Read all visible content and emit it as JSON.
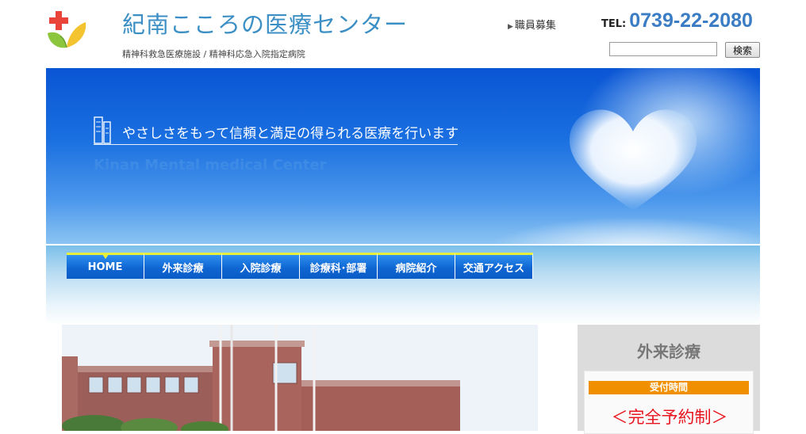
{
  "header": {
    "title": "紀南こころの医療センター",
    "subtitle": "精神科救急医療施設 / 精神科応急入院指定病院",
    "recruit_link": "職員募集",
    "tel_label": "TEL:",
    "tel_number": "0739-22-2080",
    "search": {
      "value": "",
      "placeholder": "",
      "button_label": "検索"
    }
  },
  "hero": {
    "tagline": "やさしさをもって信頼と満足の得られる医療を行います",
    "english_name": "Kinan Mental medical Center"
  },
  "nav": {
    "items": [
      {
        "label": "HOME",
        "active": true
      },
      {
        "label": "外来診療"
      },
      {
        "label": "入院診療"
      },
      {
        "label": "診療科･部署"
      },
      {
        "label": "病院紹介"
      },
      {
        "label": "交通アクセス"
      }
    ]
  },
  "sidebar": {
    "title": "外来診療",
    "reception_label": "受付時間",
    "reservation_text": "＜完全予約制＞"
  },
  "colors": {
    "title_blue": "#3b8fc4",
    "nav_blue": "#0f66d2",
    "nav_accent": "#e6f03a",
    "reception_orange": "#f09000",
    "reservation_red": "#e8141e"
  },
  "icons": [
    "hospital-logo-icon",
    "triangle-arrow-icon",
    "building-icon",
    "heart-cloud-image"
  ]
}
